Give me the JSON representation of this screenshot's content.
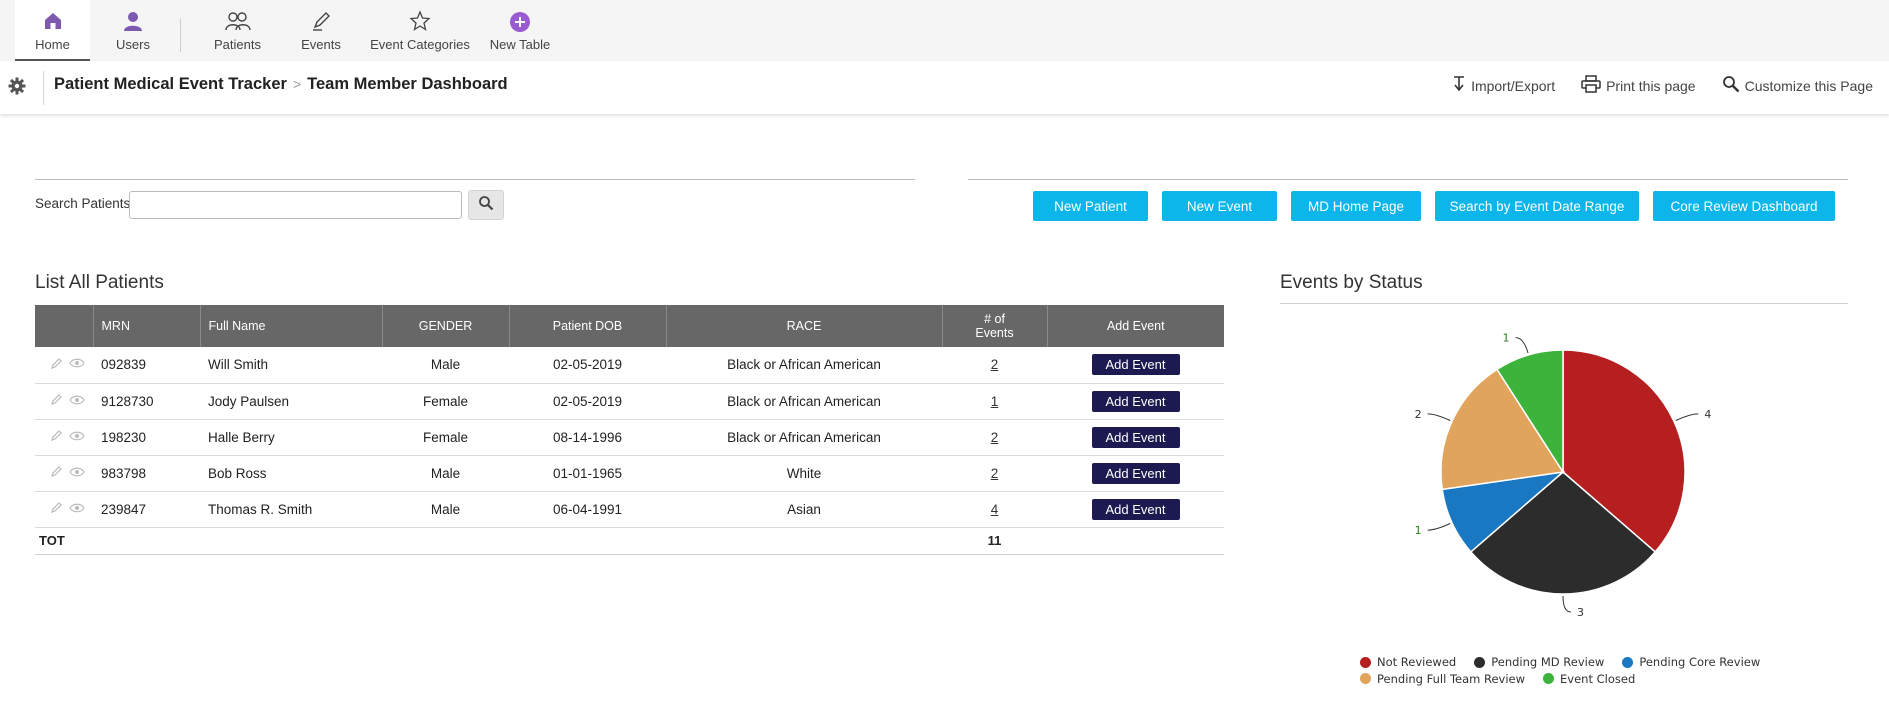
{
  "nav": {
    "items": [
      {
        "label": "Home",
        "icon": "home-icon"
      },
      {
        "label": "Users",
        "icon": "user-icon"
      },
      {
        "label": "Patients",
        "icon": "patients-icon"
      },
      {
        "label": "Events",
        "icon": "pen-icon"
      },
      {
        "label": "Event Categories",
        "icon": "star-icon"
      },
      {
        "label": "New Table",
        "icon": "plus-circle-icon"
      }
    ],
    "accent": "#7b5ab0"
  },
  "header": {
    "app_title": "Patient Medical Event Tracker",
    "separator": ">",
    "page_title": "Team Member Dashboard",
    "actions": {
      "import_export": "Import/Export",
      "print": "Print this page",
      "customize": "Customize this Page"
    }
  },
  "search": {
    "label": "Search Patients",
    "value": "",
    "placeholder": ""
  },
  "buttons": {
    "new_patient": "New Patient",
    "new_event": "New Event",
    "md_home": "MD Home Page",
    "search_date_range": "Search by Event Date Range",
    "core_review": "Core Review Dashboard",
    "color": "#0cb6ea"
  },
  "patients": {
    "title": "List All Patients",
    "columns": {
      "mrn": "MRN",
      "full_name": "Full Name",
      "gender": "GENDER",
      "dob": "Patient DOB",
      "race": "RACE",
      "events_line1": "# of",
      "events_line2": "Events",
      "add_event": "Add Event"
    },
    "rows": [
      {
        "mrn": "092839",
        "name": "Will  Smith",
        "gender": "Male",
        "dob": "02-05-2019",
        "race": "Black or African American",
        "events": "2",
        "action": "Add  Event"
      },
      {
        "mrn": "9128730",
        "name": "Jody  Paulsen",
        "gender": "Female",
        "dob": "02-05-2019",
        "race": "Black or African American",
        "events": "1",
        "action": "Add  Event"
      },
      {
        "mrn": "198230",
        "name": "Halle  Berry",
        "gender": "Female",
        "dob": "08-14-1996",
        "race": "Black or African American",
        "events": "2",
        "action": "Add  Event"
      },
      {
        "mrn": "983798",
        "name": "Bob  Ross",
        "gender": "Male",
        "dob": "01-01-1965",
        "race": "White",
        "events": "2",
        "action": "Add  Event"
      },
      {
        "mrn": "239847",
        "name": "Thomas R. Smith",
        "gender": "Male",
        "dob": "06-04-1991",
        "race": "Asian",
        "events": "4",
        "action": "Add  Event"
      }
    ],
    "total_label": "TOT",
    "total_events": "11"
  },
  "chart_data": {
    "type": "pie",
    "title": "Events by Status",
    "categories": [
      "Not Reviewed",
      "Pending MD Review",
      "Pending Core Review",
      "Pending Full Team Review",
      "Event Closed"
    ],
    "values": [
      4,
      3,
      1,
      2,
      1
    ],
    "colors": [
      "#b51f1f",
      "#2c2c2c",
      "#1a78c2",
      "#e0a45c",
      "#3cb43c"
    ],
    "legend_position": "bottom"
  }
}
